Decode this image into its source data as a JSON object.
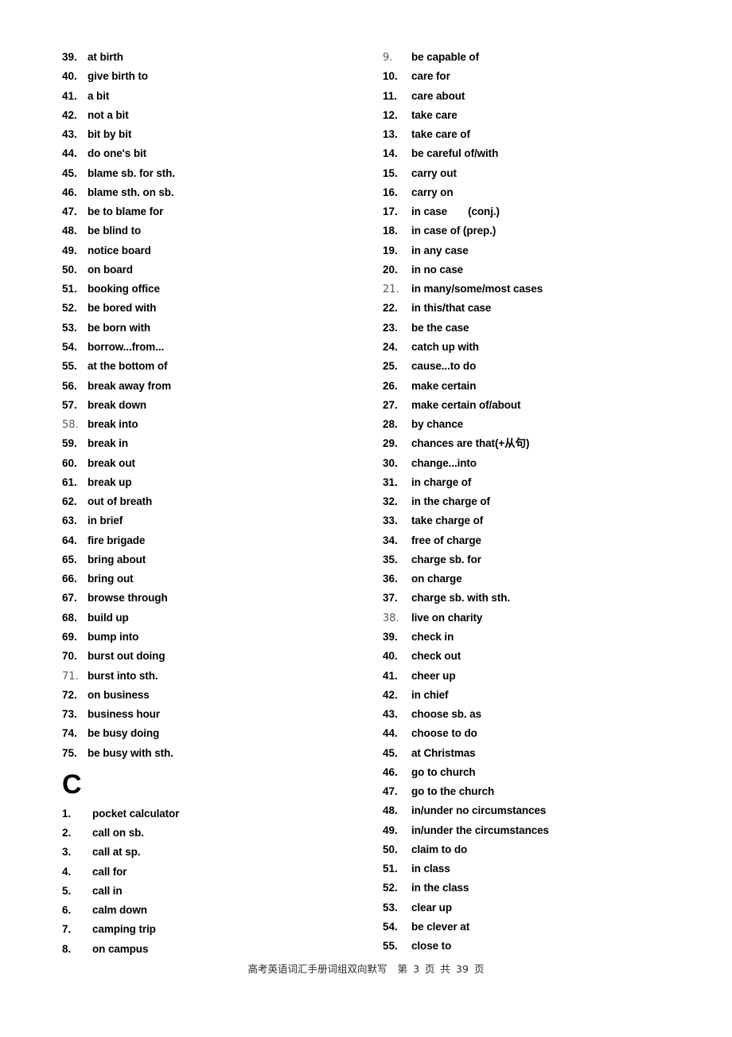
{
  "document": {
    "title": "高考英语词汇手册词组双向默写",
    "page_number": "3",
    "total_pages": "39",
    "footer_prefix": "第",
    "footer_page_unit": "页",
    "footer_total_label": "共",
    "footer_total_unit": "页"
  },
  "left_column": {
    "continued_entries": [
      {
        "num": "39.",
        "text": "at birth",
        "dim": false
      },
      {
        "num": "40.",
        "text": "give birth to",
        "dim": false
      },
      {
        "num": "41.",
        "text": "a bit",
        "dim": false
      },
      {
        "num": "42.",
        "text": "not a bit",
        "dim": false
      },
      {
        "num": "43.",
        "text": "bit by bit",
        "dim": false
      },
      {
        "num": "44.",
        "text": "do one's bit",
        "dim": false
      },
      {
        "num": "45.",
        "text": "blame sb. for sth.",
        "dim": false
      },
      {
        "num": "46.",
        "text": "blame sth. on sb.",
        "dim": false
      },
      {
        "num": "47.",
        "text": "be to blame for",
        "dim": false
      },
      {
        "num": "48.",
        "text": "be blind to",
        "dim": false
      },
      {
        "num": "49.",
        "text": "notice board",
        "dim": false
      },
      {
        "num": "50.",
        "text": "on board",
        "dim": false
      },
      {
        "num": "51.",
        "text": "booking office",
        "dim": false
      },
      {
        "num": "52.",
        "text": "be bored with",
        "dim": false
      },
      {
        "num": "53.",
        "text": "be born with",
        "dim": false
      },
      {
        "num": "54.",
        "text": "borrow...from...",
        "dim": false
      },
      {
        "num": "55.",
        "text": "at the bottom of",
        "dim": false
      },
      {
        "num": "56.",
        "text": "break away from",
        "dim": false
      },
      {
        "num": "57.",
        "text": "break down",
        "dim": false
      },
      {
        "num": "58.",
        "text": "break into",
        "dim": true
      },
      {
        "num": "59.",
        "text": "break in",
        "dim": false
      },
      {
        "num": "60.",
        "text": "break out",
        "dim": false
      },
      {
        "num": "61.",
        "text": "break up",
        "dim": false
      },
      {
        "num": "62.",
        "text": "out of breath",
        "dim": false
      },
      {
        "num": "63.",
        "text": "in brief",
        "dim": false
      },
      {
        "num": "64.",
        "text": "fire brigade",
        "dim": false
      },
      {
        "num": "65.",
        "text": "bring about",
        "dim": false
      },
      {
        "num": "66.",
        "text": "bring out",
        "dim": false
      },
      {
        "num": "67.",
        "text": "browse through",
        "dim": false
      },
      {
        "num": "68.",
        "text": "build up",
        "dim": false
      },
      {
        "num": "69.",
        "text": "bump into",
        "dim": false
      },
      {
        "num": "70.",
        "text": "burst out doing",
        "dim": false
      },
      {
        "num": "71.",
        "text": "burst into sth.",
        "dim": true
      },
      {
        "num": "72.",
        "text": "on business",
        "dim": false
      },
      {
        "num": "73.",
        "text": "business hour",
        "dim": false
      },
      {
        "num": "74.",
        "text": "be busy doing",
        "dim": false
      },
      {
        "num": "75.",
        "text": "be busy with sth.",
        "dim": false
      }
    ],
    "section_letter": "C",
    "section_entries": [
      {
        "num": "1.",
        "text": "pocket calculator",
        "dim": false
      },
      {
        "num": "2.",
        "text": "call on sb.",
        "dim": false
      },
      {
        "num": "3.",
        "text": "call at sp.",
        "dim": false
      },
      {
        "num": "4.",
        "text": "call for",
        "dim": false
      },
      {
        "num": "5.",
        "text": "call in",
        "dim": false
      },
      {
        "num": "6.",
        "text": "calm down",
        "dim": false
      },
      {
        "num": "7.",
        "text": "camping trip",
        "dim": false
      },
      {
        "num": "8.",
        "text": "on campus",
        "dim": false
      }
    ]
  },
  "right_column": {
    "entries": [
      {
        "num": "9.",
        "text": "be capable of",
        "dim": true
      },
      {
        "num": "10.",
        "text": "care for",
        "dim": false
      },
      {
        "num": "11.",
        "text": "care about",
        "dim": false
      },
      {
        "num": "12.",
        "text": "take care",
        "dim": false
      },
      {
        "num": "13.",
        "text": "take care of",
        "dim": false
      },
      {
        "num": "14.",
        "text": "be careful of/with",
        "dim": false
      },
      {
        "num": "15.",
        "text": "carry out",
        "dim": false
      },
      {
        "num": "16.",
        "text": "carry on",
        "dim": false
      },
      {
        "num": "17.",
        "text": "in case",
        "text2": "(conj.)",
        "dim": false
      },
      {
        "num": "18.",
        "text": "in case of (prep.)",
        "dim": false
      },
      {
        "num": "19.",
        "text": "in any case",
        "dim": false
      },
      {
        "num": "20.",
        "text": "in no case",
        "dim": false
      },
      {
        "num": "21.",
        "text": "in many/some/most cases",
        "dim": true
      },
      {
        "num": "22.",
        "text": "in this/that case",
        "dim": false
      },
      {
        "num": "23.",
        "text": "be the case",
        "dim": false
      },
      {
        "num": "24.",
        "text": "catch up with",
        "dim": false
      },
      {
        "num": "25.",
        "text": "cause...to do",
        "dim": false
      },
      {
        "num": "26.",
        "text": "make certain",
        "dim": false
      },
      {
        "num": "27.",
        "text": "make certain of/about",
        "dim": false
      },
      {
        "num": "28.",
        "text": "by chance",
        "dim": false
      },
      {
        "num": "29.",
        "text": "chances are that(+从句)",
        "dim": false
      },
      {
        "num": "30.",
        "text": "change...into",
        "dim": false
      },
      {
        "num": "31.",
        "text": "in charge of",
        "dim": false
      },
      {
        "num": "32.",
        "text": "in the charge of",
        "dim": false
      },
      {
        "num": "33.",
        "text": "take charge of",
        "dim": false
      },
      {
        "num": "34.",
        "text": "free of charge",
        "dim": false
      },
      {
        "num": "35.",
        "text": "charge sb. for",
        "dim": false
      },
      {
        "num": "36.",
        "text": "on charge",
        "dim": false
      },
      {
        "num": "37.",
        "text": "charge sb. with sth.",
        "dim": false
      },
      {
        "num": "38.",
        "text": "live on charity",
        "dim": true
      },
      {
        "num": "39.",
        "text": "check in",
        "dim": false
      },
      {
        "num": "40.",
        "text": "check out",
        "dim": false
      },
      {
        "num": "41.",
        "text": "cheer up",
        "dim": false
      },
      {
        "num": "42.",
        "text": "in chief",
        "dim": false
      },
      {
        "num": "43.",
        "text": "choose sb. as",
        "dim": false
      },
      {
        "num": "44.",
        "text": "choose to do",
        "dim": false
      },
      {
        "num": "45.",
        "text": "at Christmas",
        "dim": false
      },
      {
        "num": "46.",
        "text": "go to church",
        "dim": false
      },
      {
        "num": "47.",
        "text": "go to the church",
        "dim": false
      },
      {
        "num": "48.",
        "text": "in/under no circumstances",
        "dim": false
      },
      {
        "num": "49.",
        "text": "in/under the circumstances",
        "dim": false
      },
      {
        "num": "50.",
        "text": "claim to do",
        "dim": false
      },
      {
        "num": "51.",
        "text": "in class",
        "dim": false
      },
      {
        "num": "52.",
        "text": "in the class",
        "dim": false
      },
      {
        "num": "53.",
        "text": "clear up",
        "dim": false
      },
      {
        "num": "54.",
        "text": "be clever at",
        "dim": false
      },
      {
        "num": "55.",
        "text": "close to",
        "dim": false
      }
    ]
  }
}
